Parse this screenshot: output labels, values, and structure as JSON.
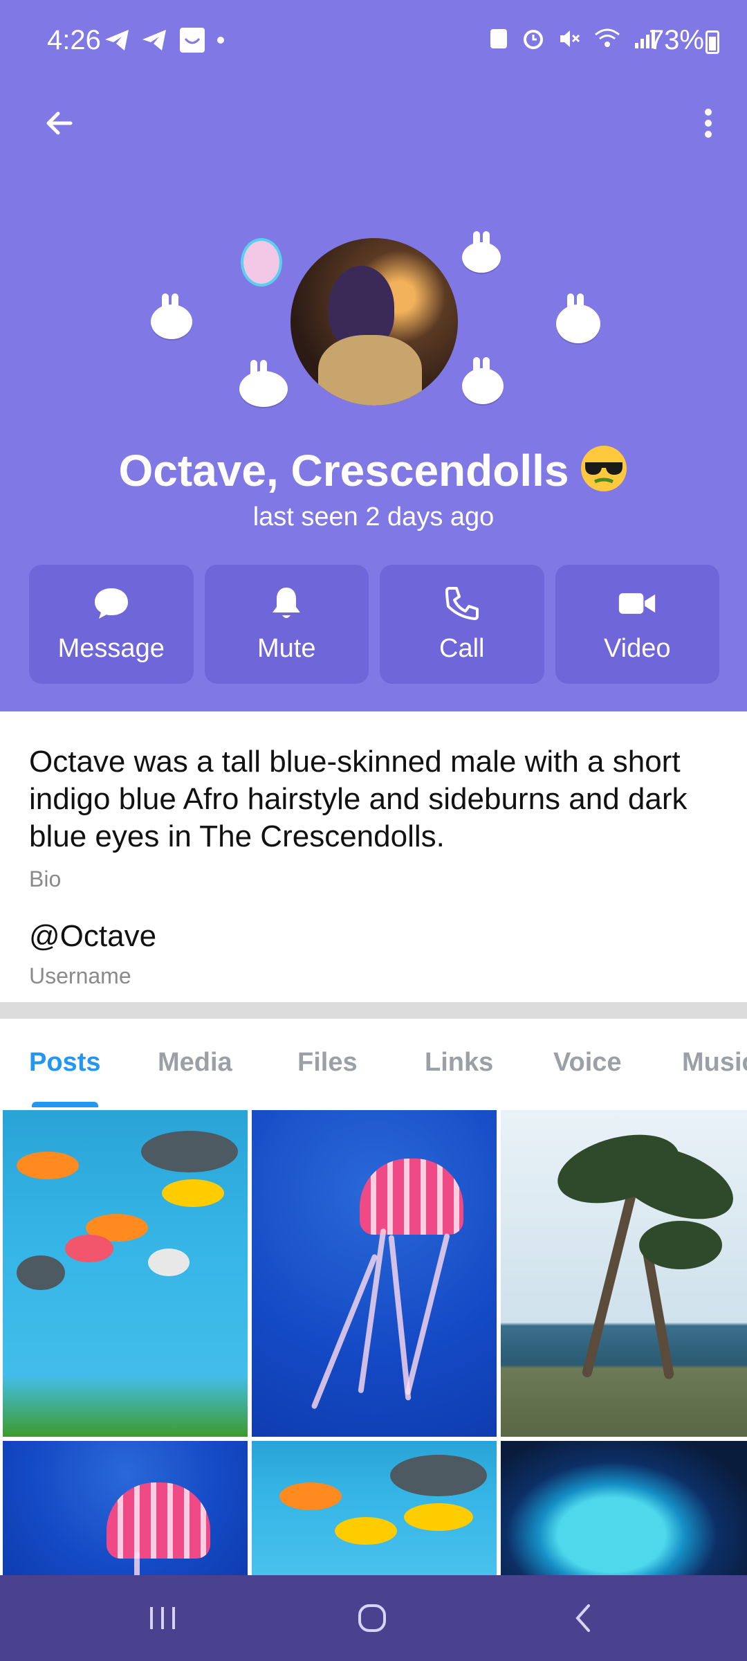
{
  "status_bar": {
    "time": "4:26",
    "battery": "73%",
    "left_icons": [
      "telegram-icon",
      "telegram-icon",
      "app-icon",
      "dot-icon"
    ],
    "right_icons": [
      "recycle-icon",
      "alarm-icon",
      "mute-icon",
      "wifi-icon",
      "signal-icon",
      "battery-icon"
    ]
  },
  "toolbar": {
    "back_icon": "arrow-left-icon",
    "more_icon": "more-vertical-icon"
  },
  "profile": {
    "name": "Octave, Crescendolls",
    "name_emoji": "sunglasses-emoji",
    "status": "last seen 2 days ago"
  },
  "actions": [
    {
      "label": "Message",
      "icon": "chat-bubble-icon"
    },
    {
      "label": "Mute",
      "icon": "bell-icon"
    },
    {
      "label": "Call",
      "icon": "phone-icon"
    },
    {
      "label": "Video",
      "icon": "video-camera-icon"
    }
  ],
  "info": {
    "bio": "Octave was a tall blue-skinned male with a short indigo blue Afro hairstyle and sideburns and dark blue eyes in The Crescendolls.",
    "bio_label": "Bio",
    "username": "@Octave",
    "username_label": "Username"
  },
  "tabs": [
    {
      "label": "Posts",
      "active": true
    },
    {
      "label": "Media",
      "active": false
    },
    {
      "label": "Files",
      "active": false
    },
    {
      "label": "Links",
      "active": false
    },
    {
      "label": "Voice",
      "active": false
    },
    {
      "label": "Music",
      "active": false
    }
  ],
  "colors": {
    "header": "#8078E4",
    "action_button": "#6f66d9",
    "accent": "#2196F3",
    "navbar": "#4a428f"
  },
  "nav_bar": [
    "recent-apps-icon",
    "home-icon",
    "back-icon"
  ]
}
